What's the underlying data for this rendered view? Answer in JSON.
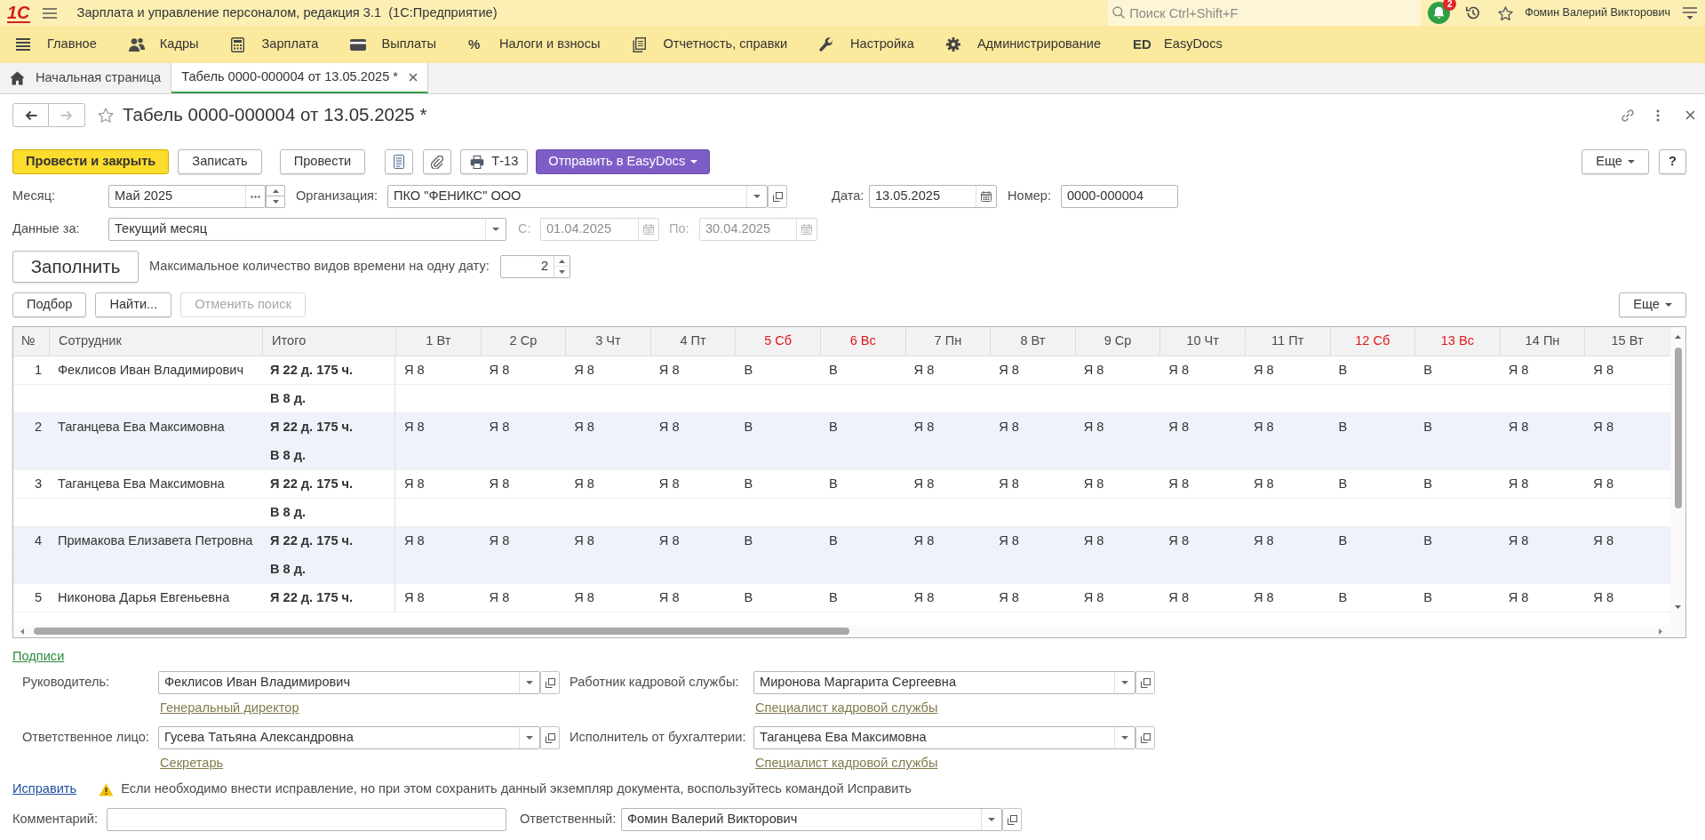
{
  "window": {
    "logo": "1С",
    "title": "Зарплата и управление персоналом, редакция 3.1  (1С:Предприятие)",
    "search": {
      "placeholder": "Поиск Ctrl+Shift+F"
    },
    "notifications": "2",
    "user": "Фомин Валерий Викторович"
  },
  "sections": [
    {
      "label": "Главное"
    },
    {
      "label": "Кадры"
    },
    {
      "label": "Зарплата"
    },
    {
      "label": "Выплаты"
    },
    {
      "label": "Налоги и взносы",
      "symbol": "%"
    },
    {
      "label": "Отчетность, справки"
    },
    {
      "label": "Настройка"
    },
    {
      "label": "Администрирование"
    },
    {
      "label": "EasyDocs",
      "symbol": "ED"
    }
  ],
  "tabs": [
    {
      "kind": "home",
      "label": "Начальная страница",
      "selected": false
    },
    {
      "kind": "document",
      "label": "Табель 0000-000004 от 13.05.2025 *",
      "selected": true
    }
  ],
  "document": {
    "navigation": [
      {
        "kind": "back",
        "disabled": false
      },
      {
        "kind": "forward",
        "disabled": true
      }
    ],
    "title": "Табель 0000-000004 от 13.05.2025 *",
    "commands": [
      {
        "kind": "primary",
        "label": "Провести и закрыть"
      },
      {
        "kind": "plain",
        "label": "Записать"
      },
      {
        "kind": "plain",
        "label": "Провести"
      },
      {
        "kind": "report"
      },
      {
        "kind": "attach"
      },
      {
        "kind": "print",
        "label": "Т-13"
      },
      {
        "kind": "menu",
        "label": "Отправить в EasyDocs"
      }
    ],
    "more": "Еще",
    "help": "?",
    "month": {
      "label": "Месяц:",
      "value": "Май 2025"
    },
    "organization": {
      "label": "Организация:",
      "value": "ПКО \"ФЕНИКС\" ООО"
    },
    "date": {
      "label": "Дата:",
      "value": "13.05.2025"
    },
    "number": {
      "label": "Номер:",
      "value": "0000-000004"
    },
    "period": {
      "label": "Данные за:",
      "value": "Текущий месяц"
    },
    "period_from": {
      "label": "С:",
      "value": "01.04.2025",
      "disabled": true
    },
    "period_to": {
      "label": "По:",
      "value": "30.04.2025",
      "disabled": true
    },
    "fill_button": "Заполнить",
    "max_types": {
      "label": "Максимальное количество видов времени на одну дату:",
      "value": "2"
    },
    "table_commands": [
      {
        "label": "Подбор",
        "disabled": false
      },
      {
        "label": "Найти...",
        "disabled": false
      },
      {
        "label": "Отменить поиск",
        "disabled": true
      }
    ],
    "table_more": "Еще",
    "table": {
      "columns": [
        "№",
        "Сотрудник",
        "Итого"
      ],
      "days": [
        {
          "label": "1 Вт",
          "weekend": false
        },
        {
          "label": "2 Ср",
          "weekend": false
        },
        {
          "label": "3 Чт",
          "weekend": false
        },
        {
          "label": "4 Пт",
          "weekend": false
        },
        {
          "label": "5 Сб",
          "weekend": true
        },
        {
          "label": "6 Вс",
          "weekend": true
        },
        {
          "label": "7 Пн",
          "weekend": false
        },
        {
          "label": "8 Вт",
          "weekend": false
        },
        {
          "label": "9 Ср",
          "weekend": false
        },
        {
          "label": "10 Чт",
          "weekend": false
        },
        {
          "label": "11 Пт",
          "weekend": false
        },
        {
          "label": "12 Сб",
          "weekend": true
        },
        {
          "label": "13 Вс",
          "weekend": true
        },
        {
          "label": "14 Пн",
          "weekend": false
        },
        {
          "label": "15 Вт",
          "weekend": false
        }
      ],
      "rows": [
        {
          "number": "1",
          "employee": "Феклисов Иван Владимирович",
          "totals": [
            "Я 22 д. 175 ч.",
            "В 8 д."
          ],
          "days": [
            "Я 8",
            "Я 8",
            "Я 8",
            "Я 8",
            "В",
            "В",
            "Я 8",
            "Я 8",
            "Я 8",
            "Я 8",
            "Я 8",
            "В",
            "В",
            "Я 8",
            "Я 8"
          ]
        },
        {
          "number": "2",
          "employee": "Таганцева Ева Максимовна",
          "totals": [
            "Я 22 д. 175 ч.",
            "В 8 д."
          ],
          "days": [
            "Я 8",
            "Я 8",
            "Я 8",
            "Я 8",
            "В",
            "В",
            "Я 8",
            "Я 8",
            "Я 8",
            "Я 8",
            "Я 8",
            "В",
            "В",
            "Я 8",
            "Я 8"
          ]
        },
        {
          "number": "3",
          "employee": "Таганцева Ева Максимовна",
          "totals": [
            "Я 22 д. 175 ч.",
            "В 8 д."
          ],
          "days": [
            "Я 8",
            "Я 8",
            "Я 8",
            "Я 8",
            "В",
            "В",
            "Я 8",
            "Я 8",
            "Я 8",
            "Я 8",
            "Я 8",
            "В",
            "В",
            "Я 8",
            "Я 8"
          ]
        },
        {
          "number": "4",
          "employee": "Примакова Елизавета Петровна",
          "totals": [
            "Я 22 д. 175 ч.",
            "В 8 д."
          ],
          "days": [
            "Я 8",
            "Я 8",
            "Я 8",
            "Я 8",
            "В",
            "В",
            "Я 8",
            "Я 8",
            "Я 8",
            "Я 8",
            "Я 8",
            "В",
            "В",
            "Я 8",
            "Я 8"
          ]
        },
        {
          "number": "5",
          "employee": "Никонова Дарья Евгеньевна",
          "totals": [
            "Я 22 д. 175 ч."
          ],
          "days": [
            "Я 8",
            "Я 8",
            "Я 8",
            "Я 8",
            "В",
            "В",
            "Я 8",
            "Я 8",
            "Я 8",
            "Я 8",
            "Я 8",
            "В",
            "В",
            "Я 8",
            "Я 8"
          ]
        }
      ]
    },
    "signatures": {
      "title": "Подписи",
      "fields": [
        {
          "label": "Руководитель:",
          "value": "Феклисов Иван Владимирович",
          "position": "Генеральный директор"
        },
        {
          "label": "Работник кадровой службы:",
          "value": "Миронова Маргарита Сергеевна",
          "position": "Специалист кадровой службы"
        },
        {
          "label": "Ответственное лицо:",
          "value": "Гусева Татьяна Александровна",
          "position": "Секретарь"
        },
        {
          "label": "Исполнитель от бухгалтерии:",
          "value": "Таганцева Ева Максимовна",
          "position": "Специалист кадровой службы"
        }
      ]
    },
    "correction": {
      "link": "Исправить",
      "message": "Если необходимо внести исправление, но при этом сохранить данный экземпляр документа, воспользуйтесь командой Исправить"
    },
    "comment": {
      "label": "Комментарий:"
    },
    "responsible": {
      "label": "Ответственный:",
      "value": "Фомин Валерий Викторович"
    }
  }
}
